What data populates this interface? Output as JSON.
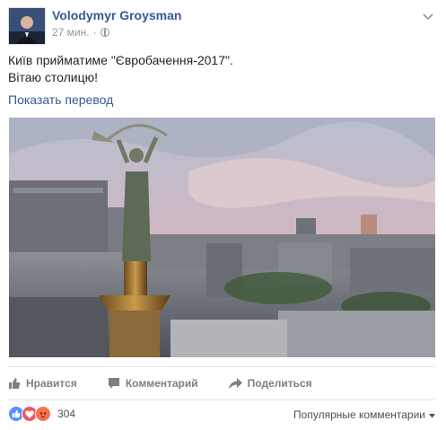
{
  "post": {
    "author": "Volodymyr Groysman",
    "time": "27 мин.",
    "separator": "·",
    "text_line1": "Київ прийматиме \"Євробачення-2017\".",
    "text_line2": "Вітаю столицю!",
    "translate_label": "Показать перевод",
    "privacy_icon": "globe-icon"
  },
  "actions": {
    "like_label": "Нравится",
    "comment_label": "Комментарий",
    "share_label": "Поделиться"
  },
  "reactions": {
    "icons": [
      "like-icon",
      "love-icon",
      "angry-icon"
    ],
    "count": "304",
    "sort_label": "Популярные комментарии"
  },
  "colors": {
    "link": "#365899",
    "meta": "#90949c",
    "like": "#5890ff",
    "love": "#f25268",
    "angry": "#f7714b"
  }
}
